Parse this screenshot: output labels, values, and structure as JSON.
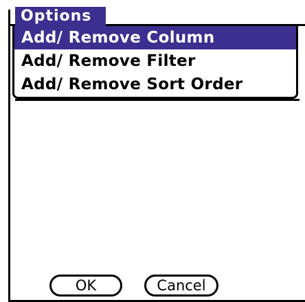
{
  "menu": {
    "title": "Options",
    "items": [
      {
        "label": "Add/ Remove Column",
        "selected": true
      },
      {
        "label": "Add/ Remove Filter",
        "selected": false
      },
      {
        "label": "Add/ Remove Sort Order",
        "selected": false
      }
    ]
  },
  "buttons": {
    "ok_label": "OK",
    "cancel_label": "Cancel"
  },
  "colors": {
    "highlight": "#3c2f8f",
    "background": "#ffffff",
    "foreground": "#000000"
  }
}
